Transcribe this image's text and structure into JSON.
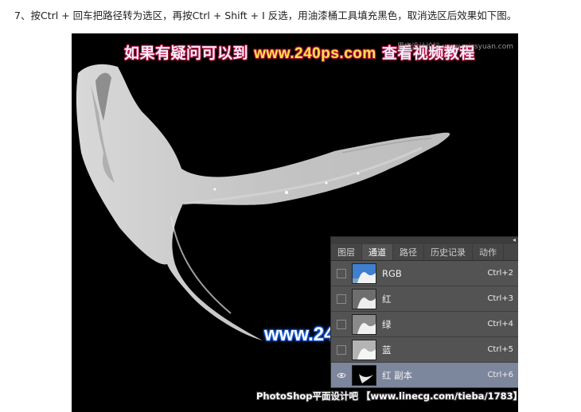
{
  "instruction": "7、按Ctrl + 回车把路径转为选区，再按Ctrl + Shift + I 反选，用油漆桶工具填充黑色，取消选区后效果如下图。",
  "watermarks": {
    "top_prefix": "如果有疑问可以到",
    "top_url": "www.240ps.com",
    "top_suffix": "查看视频教程",
    "corner": "思缘设计论坛 www.missyuan.com",
    "middle": "www.240ps.com",
    "bottom": "PhotoShop平面设计吧 【www.linecg.com/tieba/1783】"
  },
  "panel": {
    "tabs": [
      {
        "label": "图层",
        "active": false
      },
      {
        "label": "通道",
        "active": true
      },
      {
        "label": "路径",
        "active": false
      },
      {
        "label": "历史记录",
        "active": false
      },
      {
        "label": "动作",
        "active": false
      }
    ],
    "channels": [
      {
        "name": "RGB",
        "shortcut": "Ctrl+2",
        "visible": false,
        "selected": false,
        "thumb": "color"
      },
      {
        "name": "红",
        "shortcut": "Ctrl+3",
        "visible": false,
        "selected": false,
        "thumb": "gray"
      },
      {
        "name": "绿",
        "shortcut": "Ctrl+4",
        "visible": false,
        "selected": false,
        "thumb": "gray"
      },
      {
        "name": "蓝",
        "shortcut": "Ctrl+5",
        "visible": false,
        "selected": false,
        "thumb": "gray"
      },
      {
        "name": "红 副本",
        "shortcut": "Ctrl+6",
        "visible": true,
        "selected": true,
        "thumb": "mask"
      }
    ],
    "eye_icon": "eye-icon",
    "collapse_icon": "collapse-arrows-icon",
    "selected_color": "#7c869c"
  }
}
